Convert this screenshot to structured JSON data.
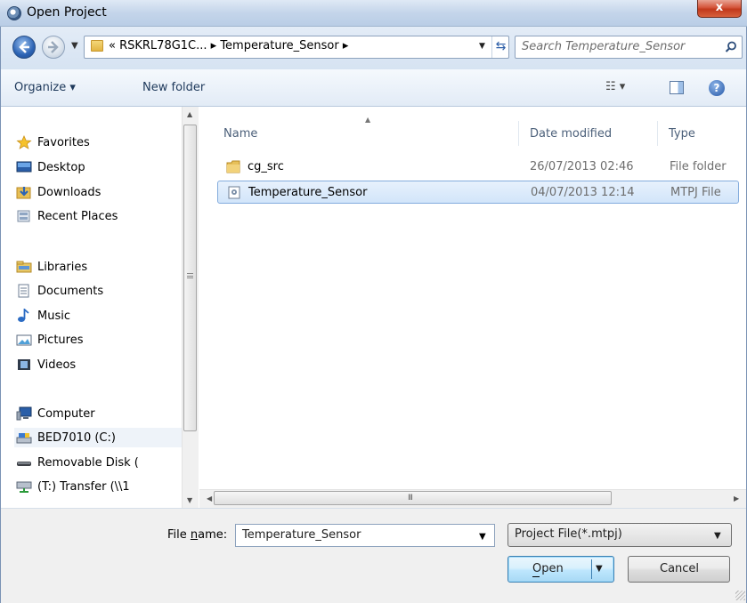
{
  "window": {
    "title": "Open Project",
    "close_glyph": "x"
  },
  "navigation": {
    "address_crumbs": "« RSKRL78G1C... ▸ Temperature_Sensor ▸",
    "search_placeholder": "Search Temperature_Sensor"
  },
  "toolbar": {
    "organize_label": "Organize ▾",
    "new_folder_label": "New folder",
    "views_label": "☷ ▾",
    "help_label": "?"
  },
  "nav_pane": {
    "items": [
      {
        "label": "Favorites",
        "icon": "star-icon"
      },
      {
        "label": "Desktop",
        "icon": "desktop-icon"
      },
      {
        "label": "Downloads",
        "icon": "downloads-icon"
      },
      {
        "label": "Recent Places",
        "icon": "recent-places-icon"
      },
      {
        "label": "Libraries",
        "icon": "libraries-icon"
      },
      {
        "label": "Documents",
        "icon": "documents-icon"
      },
      {
        "label": "Music",
        "icon": "music-icon"
      },
      {
        "label": "Pictures",
        "icon": "pictures-icon"
      },
      {
        "label": "Videos",
        "icon": "videos-icon"
      },
      {
        "label": "Computer",
        "icon": "computer-icon"
      },
      {
        "label": "BED7010 (C:)",
        "icon": "drive-icon"
      },
      {
        "label": "Removable Disk (",
        "icon": "removable-disk-icon"
      },
      {
        "label": "(T:) Transfer (\\\\1",
        "icon": "network-drive-icon"
      }
    ]
  },
  "file_list": {
    "columns": [
      "Name",
      "Date modified",
      "Type"
    ],
    "rows": [
      {
        "name": "cg_src",
        "date": "26/07/2013 02:46",
        "type": "File folder",
        "icon": "folder-icon",
        "selected": false
      },
      {
        "name": "Temperature_Sensor",
        "date": "04/07/2013 12:14",
        "type": "MTPJ File",
        "icon": "project-file-icon",
        "selected": true
      }
    ],
    "hscroll_grip": "III"
  },
  "footer": {
    "file_name_label": "File name:",
    "file_name_value": "Temperature_Sensor",
    "filter_value": "Project File(*.mtpj)",
    "open_label": "Open",
    "cancel_label": "Cancel"
  },
  "colors": {
    "accent": "#3c7fb1",
    "selection": "#d2e5fa",
    "close_button": "#c1391c"
  }
}
